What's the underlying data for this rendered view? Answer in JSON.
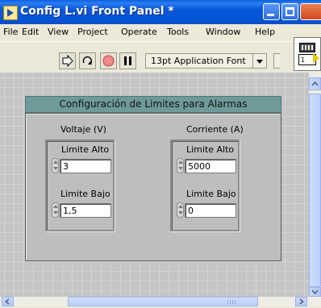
{
  "window": {
    "title": "Config L.vi Front Panel *"
  },
  "menu": {
    "items": [
      "File",
      "Edit",
      "View",
      "Project",
      "Operate",
      "Tools",
      "Window",
      "Help"
    ]
  },
  "toolbar": {
    "font": "13pt Application Font",
    "connector_number": "1"
  },
  "cluster": {
    "caption": "Configuración de Limites para Alarmas",
    "voltage": {
      "label": "Voltaje (V)",
      "high_label": "Limite Alto",
      "high_value": "3",
      "low_label": "Limite Bajo",
      "low_value": "1,5"
    },
    "current": {
      "label": "Corriente (A)",
      "high_label": "Limite Alto",
      "high_value": "5000",
      "low_label": "Limite Bajo",
      "low_value": "0"
    }
  }
}
